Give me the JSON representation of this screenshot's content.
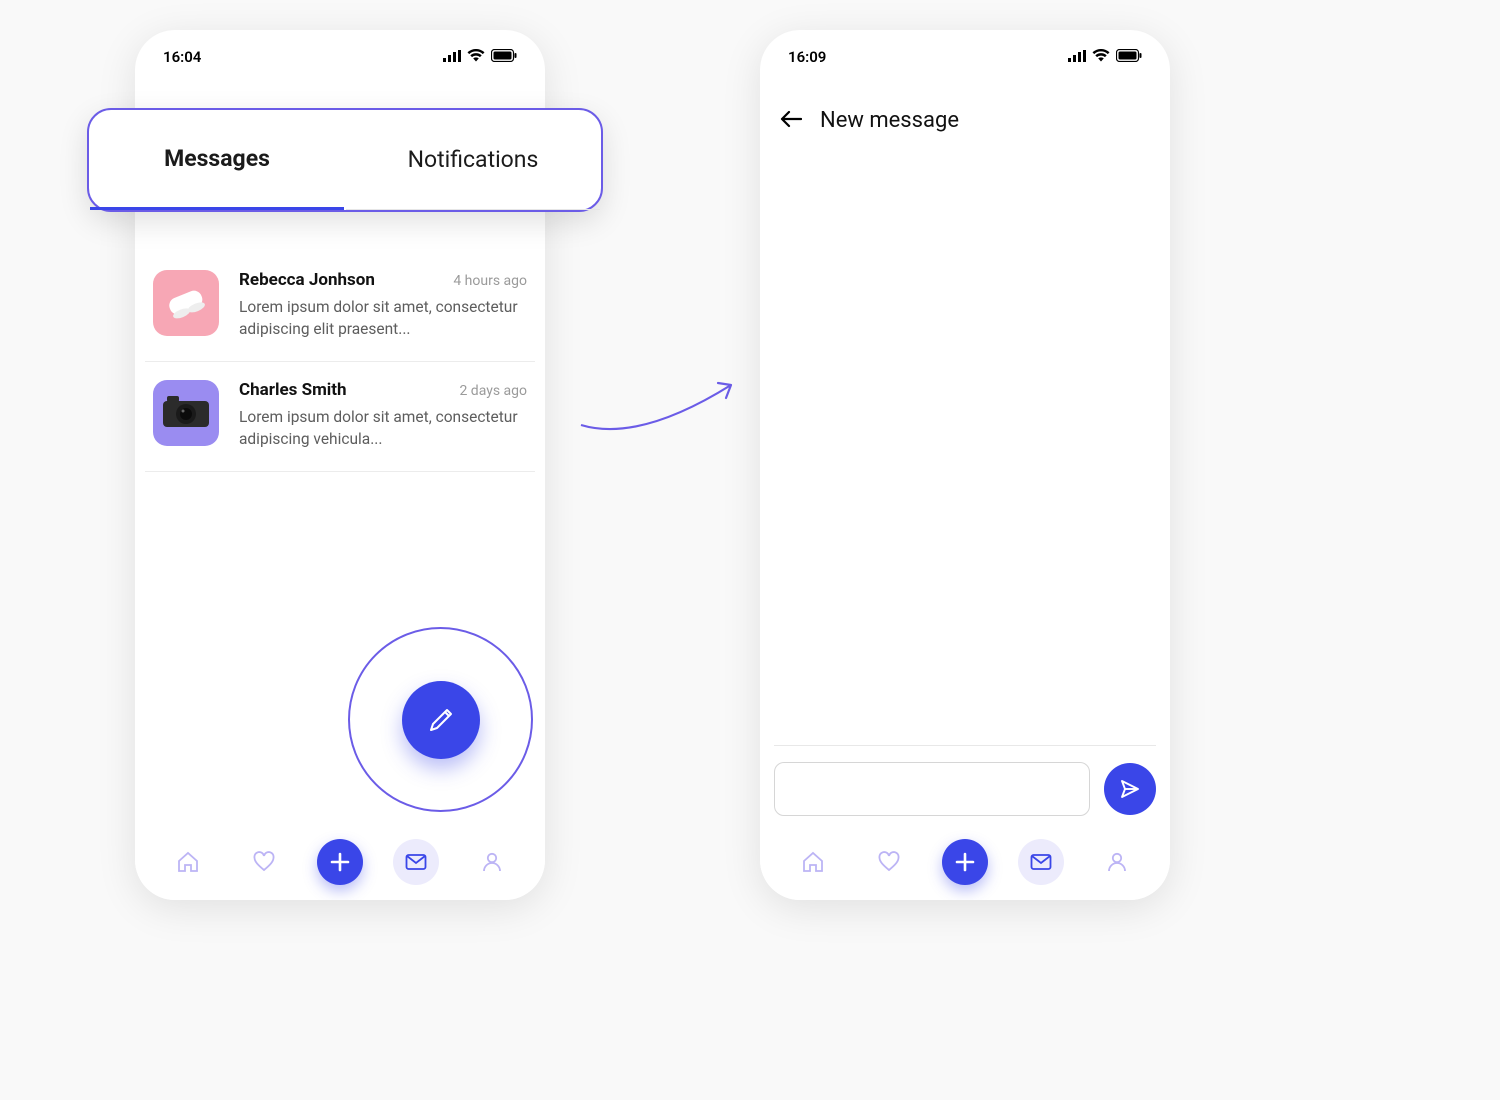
{
  "colors": {
    "primary": "#3a46e8",
    "accent_outline": "#6b5ce7",
    "icon_inactive": "#bcb4f5"
  },
  "left": {
    "status_time": "16:04",
    "tabs": {
      "messages_label": "Messages",
      "notifications_label": "Notifications"
    },
    "threads": [
      {
        "name": "Rebecca Jonhson",
        "time": "4 hours ago",
        "preview": "Lorem ipsum dolor sit amet, consectetur adipiscing elit praesent...",
        "thumb": "sneakers-photo"
      },
      {
        "name": "Charles Smith",
        "time": "2 days ago",
        "preview": "Lorem ipsum dolor sit amet, consectetur adipiscing vehicula...",
        "thumb": "camera-photo"
      }
    ],
    "fab_icon": "pencil-icon"
  },
  "right": {
    "status_time": "16:09",
    "title": "New message",
    "compose_placeholder": ""
  },
  "nav_icons": [
    "home-icon",
    "heart-icon",
    "plus-icon",
    "mail-icon",
    "user-icon"
  ]
}
